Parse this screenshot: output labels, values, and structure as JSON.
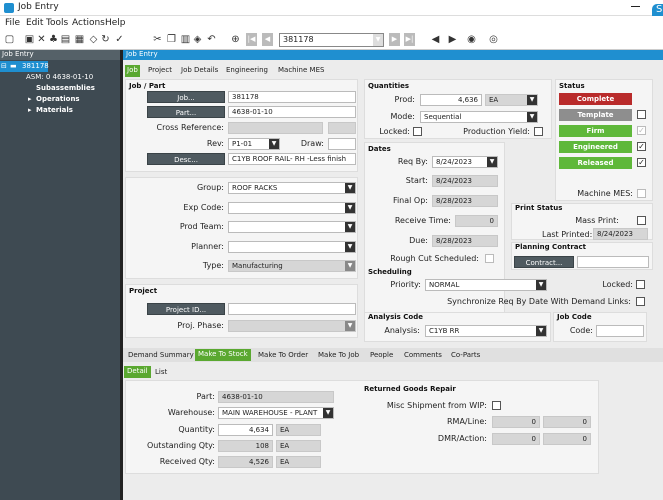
{
  "window": {
    "title": "Job Entry",
    "logo": "S"
  },
  "menu": [
    "File",
    "Edit",
    "Tools",
    "Actions",
    "Help"
  ],
  "toolbar": {
    "job_number": "381178",
    "icons": [
      "new-icon",
      "save-icon",
      "delete-icon",
      "attachment-icon",
      "print-icon",
      "clear-icon",
      "refresh-icon",
      "copy-icon",
      "paste-icon",
      "undo-icon",
      "search-icon",
      "first-icon",
      "prev-icon",
      "next-icon",
      "last-icon",
      "back-icon",
      "forward-icon",
      "stop-icon"
    ]
  },
  "tree": {
    "header": "Job Entry",
    "job": "381178",
    "asm": "ASM: 0 4638-01-10",
    "items": [
      "Subassemblies",
      "Operations",
      "Materials"
    ]
  },
  "main": {
    "header": "Job Entry",
    "tabs": [
      "Job",
      "Project",
      "Job Details",
      "Engineering",
      "Machine MES"
    ],
    "job_part": {
      "title": "Job / Part",
      "job_btn": "Job...",
      "job": "381178",
      "part_btn": "Part...",
      "part": "4638-01-10",
      "cross_ref_label": "Cross Reference:",
      "rev_label": "Rev:",
      "rev": "P1-01",
      "draw_label": "Draw:",
      "desc_btn": "Desc...",
      "desc": "C1YB ROOF RAIL- RH -Less finish"
    },
    "group": {
      "group_label": "Group:",
      "group": "ROOF RACKS",
      "exp_label": "Exp Code:",
      "prod_team_label": "Prod Team:",
      "planner_label": "Planner:",
      "type_label": "Type:",
      "type": "Manufacturing"
    },
    "project": {
      "title": "Project",
      "project_btn": "Project ID...",
      "phase_label": "Proj. Phase:"
    },
    "quantities": {
      "title": "Quantities",
      "prod_label": "Prod:",
      "prod": "4,636",
      "uom": "EA",
      "mode_label": "Mode:",
      "mode": "Sequential",
      "locked_label": "Locked:",
      "prod_yield_label": "Production Yield:"
    },
    "dates": {
      "title": "Dates",
      "req_by_label": "Req By:",
      "req_by": "8/24/2023",
      "start_label": "Start:",
      "start": "8/24/2023",
      "final_op_label": "Final Op:",
      "final_op": "8/28/2023",
      "receive_label": "Receive Time:",
      "receive": "0",
      "due_label": "Due:",
      "due": "8/28/2023",
      "rough_cut_label": "Rough Cut Scheduled:"
    },
    "scheduling": {
      "title": "Scheduling",
      "priority_label": "Priority:",
      "priority": "NORMAL",
      "locked_label": "Locked:",
      "sync_label": "Synchronize Req By Date With Demand Links:"
    },
    "analysis": {
      "title": "Analysis Code",
      "analysis_label": "Analysis:",
      "analysis": "C1YB RR"
    },
    "job_code": {
      "title": "Job Code",
      "code_label": "Code:"
    },
    "status": {
      "title": "Status",
      "complete": "Complete",
      "template": "Template",
      "firm": "Firm",
      "engineered": "Engineered",
      "released": "Released",
      "machine_mes_label": "Machine MES:",
      "colors": {
        "complete": "#b92b2b",
        "template": "#8e8e8e",
        "green": "#5fb83a"
      }
    },
    "print_status": {
      "title": "Print Status",
      "mass_print_label": "Mass Print:",
      "last_printed_label": "Last Printed:",
      "last_printed": "8/24/2023"
    },
    "planning": {
      "title": "Planning Contract",
      "contract_btn": "Contract..."
    },
    "bottom_tabs": [
      "Demand Summary",
      "Make To Stock",
      "Make To Order",
      "Make To Job",
      "People",
      "Comments",
      "Co-Parts"
    ],
    "sub_tabs": [
      "Detail",
      "List"
    ],
    "detail": {
      "part_label": "Part:",
      "part": "4638-01-10",
      "warehouse_label": "Warehouse:",
      "warehouse": "MAIN WAREHOUSE - PLANT",
      "quantity_label": "Quantity:",
      "quantity": "4,634",
      "quantity_uom": "EA",
      "outstanding_label": "Outstanding Qty:",
      "outstanding": "108",
      "outstanding_uom": "EA",
      "received_label": "Received Qty:",
      "received": "4,526",
      "received_uom": "EA"
    },
    "returns": {
      "title": "Returned Goods Repair",
      "misc_label": "Misc Shipment from WIP:",
      "rma_label": "RMA/Line:",
      "rma1": "0",
      "rma2": "0",
      "dmr_label": "DMR/Action:",
      "dmr1": "0",
      "dmr2": "0"
    }
  }
}
